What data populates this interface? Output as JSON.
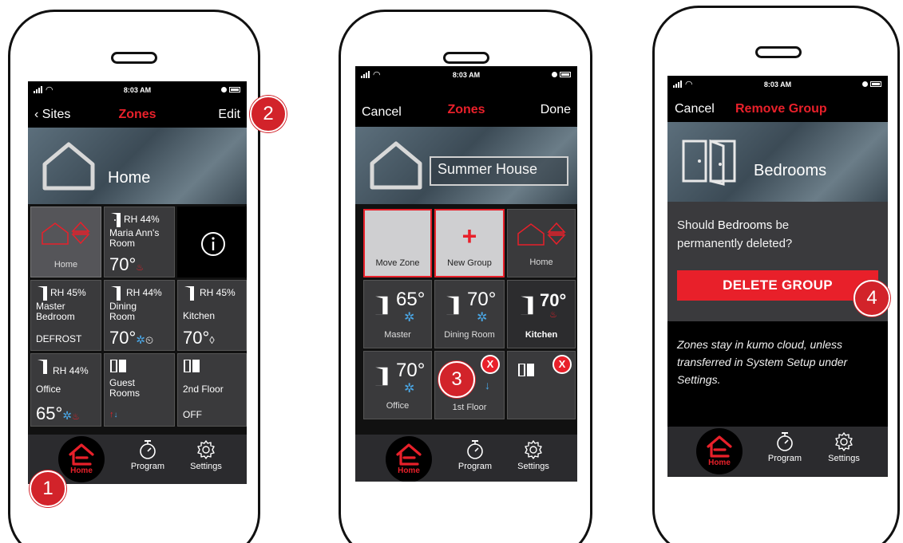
{
  "status": {
    "time": "8:03 AM"
  },
  "screen1": {
    "nav": {
      "left": "Sites",
      "title": "Zones",
      "right": "Edit"
    },
    "site_name": "Home",
    "tiles": [
      {
        "name": "Home"
      },
      {
        "rh": "RH 44%",
        "name": "Maria Ann's Room",
        "temp": "70°"
      },
      {
        "name": "Master Bedroom",
        "rh": "RH 45%",
        "foot": "DEFROST"
      },
      {
        "name": "Dining Room",
        "rh": "RH 44%",
        "temp": "70°"
      },
      {
        "name": "Kitchen",
        "rh": "RH 45%",
        "temp": "70°"
      },
      {
        "name": "Office",
        "rh": "RH 44%",
        "temp": "65°"
      },
      {
        "name": "Guest Rooms"
      },
      {
        "name": "2nd Floor",
        "foot": "OFF"
      }
    ],
    "tabs": {
      "home": "Home",
      "program": "Program",
      "settings": "Settings"
    }
  },
  "screen2": {
    "nav": {
      "left": "Cancel",
      "title": "Zones",
      "right": "Done"
    },
    "site_input": "Summer House",
    "tiles": [
      {
        "name": "Move Zone"
      },
      {
        "name": "New Group"
      },
      {
        "name": "Home"
      },
      {
        "name": "Master",
        "temp": "65°"
      },
      {
        "name": "Dining Room",
        "temp": "70°"
      },
      {
        "name": "Kitchen",
        "temp": "70°"
      },
      {
        "name": "Office",
        "temp": "70°"
      },
      {
        "name": "1st Floor"
      }
    ],
    "x_label": "X",
    "tabs": {
      "home": "Home",
      "program": "Program",
      "settings": "Settings"
    }
  },
  "screen3": {
    "nav": {
      "left": "Cancel",
      "title": "Remove Group"
    },
    "group_name": "Bedrooms",
    "question_pre": "Should",
    "question_name": "Bedrooms",
    "question_post": "be",
    "question_line2": "permanently deleted?",
    "delete_label": "DELETE GROUP",
    "note": "Zones stay in kumo cloud, unless transferred in System Setup under Settings.",
    "tabs": {
      "home": "Home",
      "program": "Program",
      "settings": "Settings"
    }
  },
  "callouts": [
    "1",
    "2",
    "3",
    "4"
  ],
  "colors": {
    "accent": "#e8202a",
    "cool": "#4aa8e8",
    "callout": "#d2232a"
  }
}
